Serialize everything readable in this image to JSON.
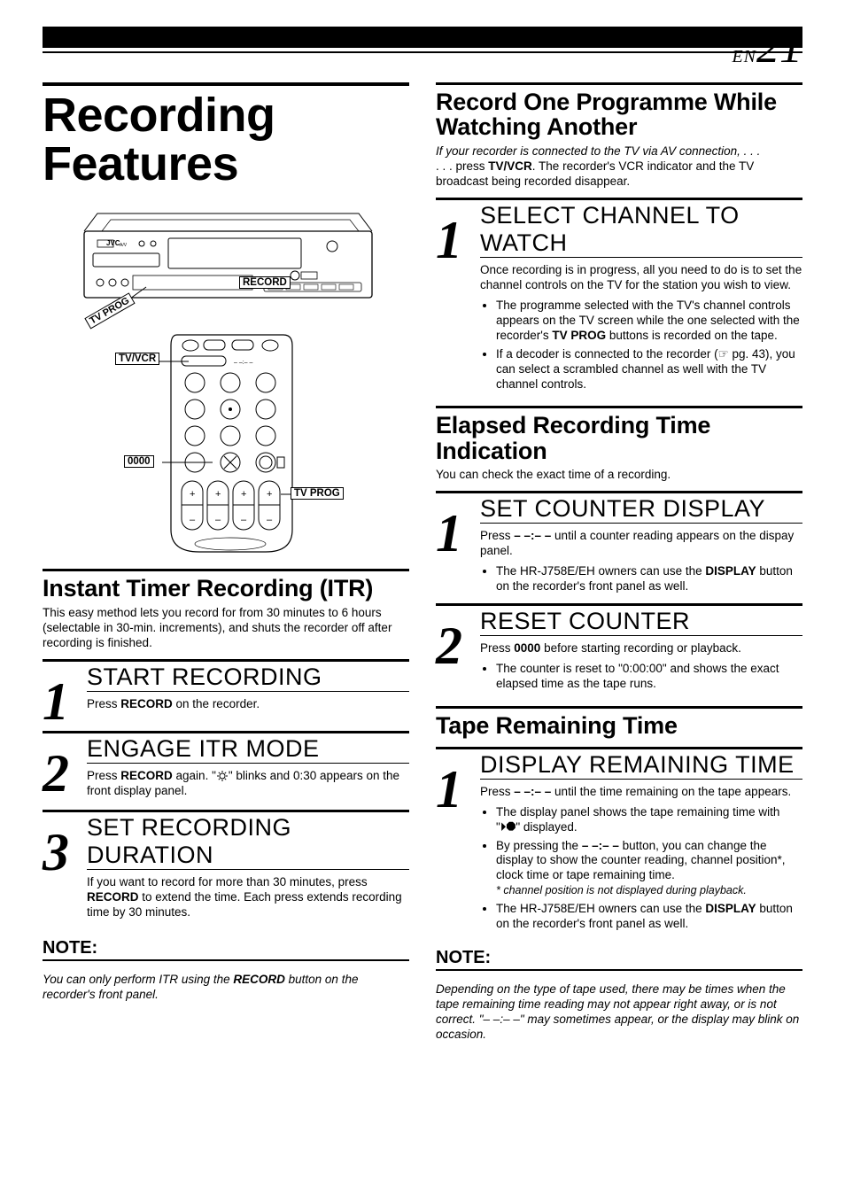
{
  "page": {
    "en": "EN",
    "num": "21"
  },
  "left": {
    "title": "Recording Features",
    "diagram": {
      "vcr_brand": "JVC",
      "record_label": "RECORD",
      "tvprog_tag": "TV PROG",
      "tvvcr_label": "TV/VCR",
      "zero_label": "0000",
      "tvprog_label": "TV PROG"
    },
    "itr": {
      "heading": "Instant Timer Recording (ITR)",
      "intro": "This easy method lets you record for from 30 minutes to 6 hours (selectable in 30-min. increments), and shuts the recorder off after recording is finished.",
      "step1_title": "START RECORDING",
      "step1_body_a": "Press ",
      "step1_body_b": "RECORD",
      "step1_body_c": " on the recorder.",
      "step2_title": "ENGAGE ITR MODE",
      "step2_body_a": "Press ",
      "step2_body_b": "RECORD",
      "step2_body_c": " again. \"",
      "step2_body_d": "\" blinks and 0:30 appears on the front display panel.",
      "step3_title": "SET RECORDING DURATION",
      "step3_body_a": "If you want to record for more than 30 minutes, press ",
      "step3_body_b": "RECORD",
      "step3_body_c": " to extend the time. Each press extends recording time by 30 minutes.",
      "note_head": "NOTE:",
      "note_body_a": "You can only perform ITR using the ",
      "note_body_b": "RECORD",
      "note_body_c": " button on the recorder's front panel."
    }
  },
  "right": {
    "rec_watch": {
      "heading": "Record One Programme While Watching Another",
      "intro_a": "If your recorder is connected to the TV via AV connection, . . .",
      "intro_b_a": ". . . press ",
      "intro_b_b": "TV/VCR",
      "intro_b_c": ". The recorder's VCR indicator and the TV broadcast being recorded disappear.",
      "step1_title": "SELECT CHANNEL TO WATCH",
      "step1_body": "Once recording is in progress, all you need to do is to set the channel controls on the TV for the station you wish to view.",
      "b1_a": "The programme selected with the TV's channel controls appears on the TV screen while the one selected with the recorder's ",
      "b1_b": "TV PROG",
      "b1_c": " buttons is recorded on the tape.",
      "b2": "If a decoder is connected to the recorder (☞ pg. 43), you can select a scrambled channel as well with the TV channel controls."
    },
    "elapsed": {
      "heading": "Elapsed Recording Time Indication",
      "intro": "You can check the exact time of a recording.",
      "step1_title": "SET COUNTER DISPLAY",
      "step1_body_a": "Press ",
      "step1_body_b": "– –:– –",
      "step1_body_c": " until a counter reading appears on the dispay panel.",
      "step1_bullet_a": "The HR-J758E/EH owners can use the ",
      "step1_bullet_b": "DISPLAY",
      "step1_bullet_c": " button on the recorder's front panel as well.",
      "step2_title": "RESET COUNTER",
      "step2_body_a": "Press ",
      "step2_body_b": "0000",
      "step2_body_c": " before starting recording or playback.",
      "step2_bullet": "The counter is reset to \"0:00:00\" and shows the exact elapsed time as the tape runs."
    },
    "remaining": {
      "heading": "Tape Remaining Time",
      "step1_title": "DISPLAY REMAINING TIME",
      "step1_body_a": "Press ",
      "step1_body_b": "– –:– –",
      "step1_body_c": " until the time remaining on the tape appears.",
      "b1": "The display panel shows the tape remaining time with \"⏵⯃\" displayed.",
      "b2_a": "By pressing the ",
      "b2_b": "– –:– –",
      "b2_c": " button, you can change the display to show the counter reading, channel position*, clock time or tape remaining time.",
      "b2_foot": "* channel position is not displayed during playback.",
      "b3_a": "The HR-J758E/EH owners can use the ",
      "b3_b": "DISPLAY",
      "b3_c": " button on the recorder's front panel as well.",
      "note_head": "NOTE:",
      "note_body": "Depending on the type of tape used, there may be times when the tape remaining time reading may not appear right away, or is not correct. \"– –:– –\" may sometimes appear, or the display may blink on occasion."
    }
  }
}
